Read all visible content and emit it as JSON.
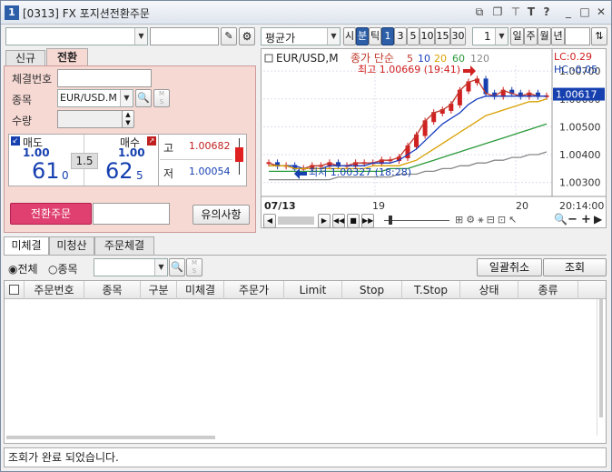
{
  "window": {
    "num": "1",
    "title": "[0313] FX 포지션전환주문"
  },
  "toolbar": {
    "period_type": "평균가",
    "periods": [
      "시",
      "분",
      "틱",
      "1",
      "3",
      "5",
      "10",
      "15",
      "30"
    ],
    "count": "1",
    "periods2": [
      "일",
      "주",
      "월",
      "년"
    ]
  },
  "tabs": {
    "new": "신규",
    "convert": "전환"
  },
  "form": {
    "conclusion_no_label": "체결번호",
    "symbol_label": "종목",
    "symbol_value": "EUR/USD.M",
    "qty_label": "수량",
    "ms_label": "M",
    "ms_label2": "S"
  },
  "quote": {
    "sell_label": "매도",
    "sell_qty": "1.00",
    "sell_big": "61",
    "sell_small": "0",
    "spread": "1.5",
    "buy_label": "매수",
    "buy_qty": "1.00",
    "buy_big": "62",
    "buy_small": "5",
    "high_label": "고",
    "high_value": "1.00682",
    "low_label": "저",
    "low_value": "1.00054"
  },
  "buttons": {
    "convert_order": "전환주문",
    "notice": "유의사항",
    "cancel_all": "일괄취소",
    "query": "조회"
  },
  "chart": {
    "symbol": "EUR/USD,M",
    "ma_label": "종가 단순",
    "ma_periods": [
      "5",
      "10",
      "20",
      "60",
      "120"
    ],
    "ma_colors": [
      "#c0392b",
      "#1a3fbf",
      "#d8a000",
      "#2a9a3a",
      "#888888"
    ],
    "high_note": "최고 1.00669 (19:41)",
    "low_note": "최저 1.00327 (18:28)",
    "lc": "LC:0.29",
    "hc": "HC:-0.05",
    "price_tag": "1.00617",
    "y_ticks": [
      "1.00700",
      "1.00600",
      "1.00500",
      "1.00400",
      "1.00300"
    ],
    "x_date": "07/13",
    "x_ticks": [
      "19",
      "20"
    ],
    "x_last": "20:14:00"
  },
  "chart_data": {
    "type": "line",
    "ylim": [
      1.0025,
      1.0072
    ],
    "series": [
      {
        "values": [
          1.0037,
          1.0036,
          1.0036,
          1.0035,
          1.0035,
          1.0036,
          1.0036,
          1.0037,
          1.0036,
          1.0036,
          1.0037,
          1.0037,
          1.0037,
          1.0038,
          1.0038,
          1.0039,
          1.0043,
          1.0047,
          1.0052,
          1.0055,
          1.0056,
          1.0058,
          1.0063,
          1.0066,
          1.0067,
          1.0062,
          1.0061,
          1.0063,
          1.0062,
          1.0061,
          1.0062,
          1.0061,
          1.0061
        ]
      },
      {
        "values": [
          1.0036,
          1.0036,
          1.0036,
          1.0036,
          1.0035,
          1.0035,
          1.0035,
          1.0036,
          1.0036,
          1.0036,
          1.0036,
          1.0036,
          1.0037,
          1.0037,
          1.0037,
          1.0038,
          1.004,
          1.0042,
          1.0045,
          1.0048,
          1.0051,
          1.0053,
          1.0055,
          1.0058,
          1.006,
          1.0061,
          1.0061,
          1.0061,
          1.0061,
          1.0061,
          1.0061,
          1.0061,
          1.0061
        ]
      },
      {
        "values": [
          1.0036,
          1.0036,
          1.0036,
          1.0035,
          1.0035,
          1.0035,
          1.0035,
          1.0035,
          1.0035,
          1.0035,
          1.0035,
          1.0035,
          1.0036,
          1.0036,
          1.0036,
          1.0036,
          1.0037,
          1.0038,
          1.004,
          1.0042,
          1.0044,
          1.0046,
          1.0048,
          1.005,
          1.0052,
          1.0054,
          1.0055,
          1.0056,
          1.0057,
          1.0058,
          1.0059,
          1.0059,
          1.006
        ]
      },
      {
        "values": [
          1.0034,
          1.0034,
          1.0034,
          1.0034,
          1.0034,
          1.0034,
          1.0034,
          1.0034,
          1.0034,
          1.0034,
          1.0034,
          1.0034,
          1.0034,
          1.0034,
          1.0035,
          1.0035,
          1.0035,
          1.0036,
          1.0037,
          1.0038,
          1.0039,
          1.004,
          1.0041,
          1.0042,
          1.0043,
          1.0044,
          1.0045,
          1.0046,
          1.0047,
          1.0048,
          1.0049,
          1.005,
          1.0051
        ]
      },
      {
        "values": [
          1.0031,
          1.0031,
          1.0031,
          1.0031,
          1.0031,
          1.0031,
          1.0031,
          1.0031,
          1.0032,
          1.0032,
          1.0032,
          1.0032,
          1.0032,
          1.0032,
          1.0032,
          1.0033,
          1.0033,
          1.0033,
          1.0034,
          1.0034,
          1.0035,
          1.0035,
          1.0036,
          1.0036,
          1.0037,
          1.0037,
          1.0038,
          1.0038,
          1.0039,
          1.0039,
          1.004,
          1.004,
          1.0041
        ]
      }
    ]
  },
  "tabs2": [
    "미체결",
    "미청산",
    "주문체결"
  ],
  "filter": {
    "all": "전체",
    "symbol": "종목"
  },
  "table": {
    "headers": [
      "주문번호",
      "종목",
      "구분",
      "미체결",
      "주문가",
      "Limit",
      "Stop",
      "T.Stop",
      "상태",
      "종류"
    ]
  },
  "status": "조회가 완료 되었습니다."
}
